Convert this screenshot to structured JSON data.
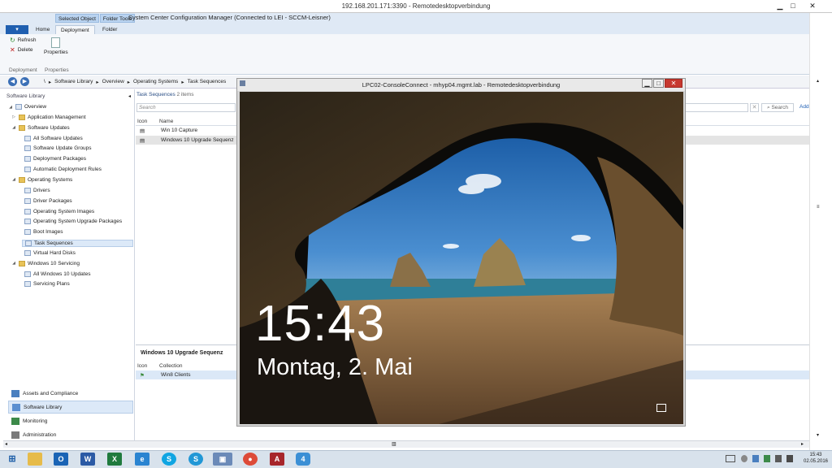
{
  "rdp_window": {
    "title": "192.168.201.171:3390 - Remotedesktopverbindung",
    "min": "▁",
    "max": "□",
    "close": "✕"
  },
  "ribbon": {
    "context_tabs": [
      "Selected Object",
      "Folder Tools"
    ],
    "app_title": "System Center Configuration Manager (Connected to LEI - SCCM-Leisner)",
    "file_menu": "▾",
    "tabs": [
      "Home",
      "Deployment",
      "Folder"
    ],
    "refresh": "Refresh",
    "delete": "Delete",
    "properties": "Properties",
    "group_deployment": "Deployment",
    "group_properties": "Properties"
  },
  "breadcrumb": [
    "\\",
    "Software Library",
    "Overview",
    "Operating Systems",
    "Task Sequences"
  ],
  "navigation": {
    "header": "Software Library",
    "tree": [
      {
        "label": "Overview",
        "level": 0,
        "expanded": true,
        "icon": "overview-icon"
      },
      {
        "label": "Application Management",
        "level": 1,
        "expanded": false,
        "icon": "folder-icon"
      },
      {
        "label": "Software Updates",
        "level": 1,
        "expanded": true,
        "icon": "folder-icon"
      },
      {
        "label": "All Software Updates",
        "level": 2,
        "icon": "doc-icon"
      },
      {
        "label": "Software Update Groups",
        "level": 2,
        "icon": "doc-icon"
      },
      {
        "label": "Deployment Packages",
        "level": 2,
        "icon": "doc-icon"
      },
      {
        "label": "Automatic Deployment Rules",
        "level": 2,
        "icon": "doc-icon"
      },
      {
        "label": "Operating Systems",
        "level": 1,
        "expanded": true,
        "icon": "folder-icon"
      },
      {
        "label": "Drivers",
        "level": 2,
        "icon": "doc-icon"
      },
      {
        "label": "Driver Packages",
        "level": 2,
        "icon": "doc-icon"
      },
      {
        "label": "Operating System Images",
        "level": 2,
        "icon": "doc-icon"
      },
      {
        "label": "Operating System Upgrade Packages",
        "level": 2,
        "icon": "doc-icon"
      },
      {
        "label": "Boot Images",
        "level": 2,
        "icon": "doc-icon"
      },
      {
        "label": "Task Sequences",
        "level": 2,
        "icon": "doc-icon",
        "selected": true
      },
      {
        "label": "Virtual Hard Disks",
        "level": 2,
        "icon": "doc-icon"
      },
      {
        "label": "Windows 10 Servicing",
        "level": 1,
        "expanded": true,
        "icon": "folder-icon"
      },
      {
        "label": "All Windows 10 Updates",
        "level": 2,
        "icon": "doc-icon"
      },
      {
        "label": "Servicing Plans",
        "level": 2,
        "icon": "doc-icon"
      }
    ],
    "workspaces": [
      {
        "label": "Assets and Compliance",
        "selected": false
      },
      {
        "label": "Software Library",
        "selected": true
      },
      {
        "label": "Monitoring",
        "selected": false
      },
      {
        "label": "Administration",
        "selected": false
      }
    ]
  },
  "main": {
    "title": "Task Sequences",
    "count": "2 items",
    "search_placeholder": "Search",
    "search_button": "Search",
    "add_link": "Add",
    "columns": [
      "Icon",
      "Name"
    ],
    "rows": [
      {
        "name": "Win 10 Capture",
        "selected": false
      },
      {
        "name": "Windows 10 Upgrade Sequenz",
        "selected": true
      }
    ],
    "detail": {
      "title": "Windows 10 Upgrade Sequenz",
      "columns": [
        "Icon",
        "Collection"
      ],
      "rows": [
        "Win8 Clients"
      ]
    }
  },
  "inner_rdp": {
    "title": "LPC02-ConsoleConnect - mhyp04.mgmt.lab - Remotedesktopverbindung",
    "min": "▁",
    "max": "□",
    "close": "✕",
    "time": "15:43",
    "date": "Montag, 2. Mai"
  },
  "taskbar": {
    "apps": [
      "Start",
      "File Explorer",
      "Outlook",
      "Word",
      "Excel",
      "Internet Explorer",
      "Skype",
      "Skype for Business",
      "Remote Desktop",
      "Chrome",
      "Access",
      "Task View"
    ],
    "time": "15:43",
    "date": "02.05.2016"
  }
}
